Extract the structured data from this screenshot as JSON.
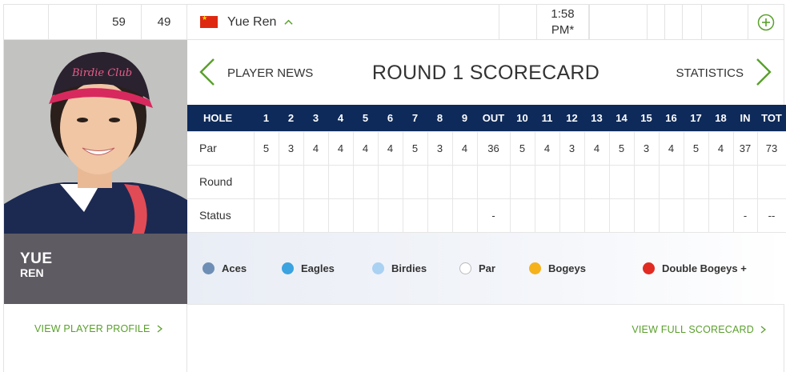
{
  "top_row": {
    "col_a": "59",
    "col_b": "49",
    "player_name": "Yue Ren",
    "time": "1:58 PM*",
    "time_line1": "1:58",
    "time_line2": "PM*"
  },
  "player": {
    "first_name": "YUE",
    "last_name": "REN",
    "profile_link": "VIEW PLAYER PROFILE"
  },
  "scorecard": {
    "title": "ROUND 1 SCORECARD",
    "prev_label": "PLAYER NEWS",
    "next_label": "STATISTICS",
    "headers": [
      "HOLE",
      "1",
      "2",
      "3",
      "4",
      "5",
      "6",
      "7",
      "8",
      "9",
      "OUT",
      "10",
      "11",
      "12",
      "13",
      "14",
      "15",
      "16",
      "17",
      "18",
      "IN",
      "TOT"
    ],
    "rows": [
      {
        "label": "Par",
        "cells": [
          "5",
          "3",
          "4",
          "4",
          "4",
          "4",
          "5",
          "3",
          "4",
          "36",
          "5",
          "4",
          "3",
          "4",
          "5",
          "3",
          "4",
          "5",
          "4",
          "37",
          "73"
        ]
      },
      {
        "label": "Round",
        "cells": [
          "",
          "",
          "",
          "",
          "",
          "",
          "",
          "",
          "",
          "",
          "",
          "",
          "",
          "",
          "",
          "",
          "",
          "",
          "",
          "",
          ""
        ]
      },
      {
        "label": "Status",
        "cells": [
          "",
          "",
          "",
          "",
          "",
          "",
          "",
          "",
          "",
          "-",
          "",
          "",
          "",
          "",
          "",
          "",
          "",
          "",
          "",
          "-",
          "--"
        ]
      }
    ],
    "full_link": "VIEW FULL SCORECARD"
  },
  "legend": [
    {
      "label": "Aces",
      "color": "#6e8fb5"
    },
    {
      "label": "Eagles",
      "color": "#3aa3e0"
    },
    {
      "label": "Birdies",
      "color": "#a9d1f2"
    },
    {
      "label": "Par",
      "color": "#ffffff"
    },
    {
      "label": "Bogeys",
      "color": "#f5b21b"
    },
    {
      "label": "Double Bogeys +",
      "color": "#e12b22"
    }
  ],
  "colors": {
    "header_bg": "#0e2a5a",
    "accent_green": "#5aa02c",
    "name_bg": "#5f5b63"
  }
}
